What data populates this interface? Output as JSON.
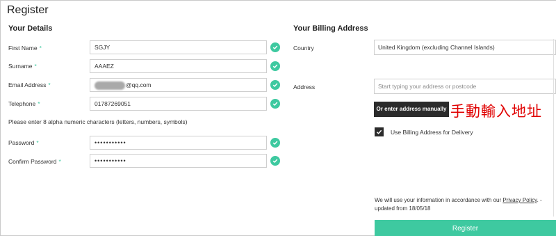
{
  "page": {
    "title": "Register"
  },
  "details": {
    "heading": "Your Details",
    "required_mark": "*",
    "first_name": {
      "label": "First Name",
      "value": "SGJY"
    },
    "surname": {
      "label": "Surname",
      "value": "AAAEZ"
    },
    "email": {
      "label": "Email Address",
      "value_suffix": "@qq.com"
    },
    "telephone": {
      "label": "Telephone",
      "value": "01787269051"
    },
    "password_note": "Please enter 8 alpha numeric characters (letters, numbers, symbols)",
    "password": {
      "label": "Password",
      "value": "•••••••••••"
    },
    "confirm_password": {
      "label": "Confirm Password",
      "value": "•••••••••••"
    }
  },
  "billing": {
    "heading": "Your Billing Address",
    "country": {
      "label": "Country",
      "value": "United Kingdom (excluding Channel Islands)"
    },
    "address": {
      "label": "Address",
      "placeholder": "Start typing your address or postcode"
    },
    "manual_button": "Or enter address manually",
    "annotation": "手動輸入地址",
    "use_billing_label": "Use Billing Address for Delivery",
    "use_billing_checked": true,
    "privacy_prefix": "We will use your information in accordance with our ",
    "privacy_link": "Privacy Policy",
    "privacy_suffix": ". - updated from 18/05/18",
    "register_button": "Register"
  },
  "colors": {
    "accent": "#3ec9a0",
    "dark_button": "#2b2b2b",
    "annotation": "#e00000"
  }
}
